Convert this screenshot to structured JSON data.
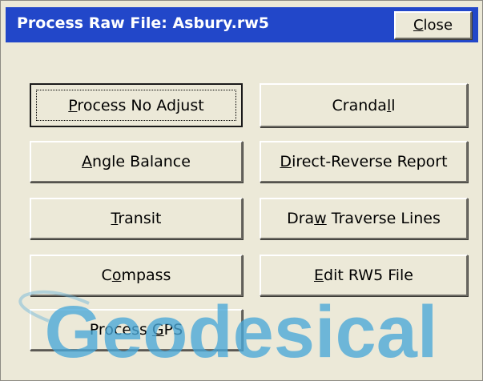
{
  "window": {
    "title": "Process Raw File: Asbury.rw5",
    "close_button": {
      "label": "Close",
      "mnemonic": "C"
    }
  },
  "buttons": {
    "process_no_adjust": {
      "label": "Process No Adjust",
      "mnemonic": "P"
    },
    "crandall": {
      "label": "Crandall",
      "mnemonic": "l"
    },
    "angle_balance": {
      "label": "Angle Balance",
      "mnemonic": "A"
    },
    "direct_reverse_report": {
      "label": "Direct-Reverse Report",
      "mnemonic": "D"
    },
    "transit": {
      "label": "Transit",
      "mnemonic": "T"
    },
    "draw_traverse_lines": {
      "label": "Draw Traverse Lines",
      "mnemonic": "w"
    },
    "compass": {
      "label": "Compass",
      "mnemonic": "o"
    },
    "edit_rw5_file": {
      "label": "Edit RW5 File",
      "mnemonic": "E"
    },
    "process_gps": {
      "label": "Process GPS",
      "mnemonic": "G"
    }
  },
  "watermark": {
    "text": "Geodesical"
  },
  "colors": {
    "titlebar": "#2247c9",
    "dialog_bg": "#ece9d8",
    "watermark": "#4aa8d8"
  }
}
